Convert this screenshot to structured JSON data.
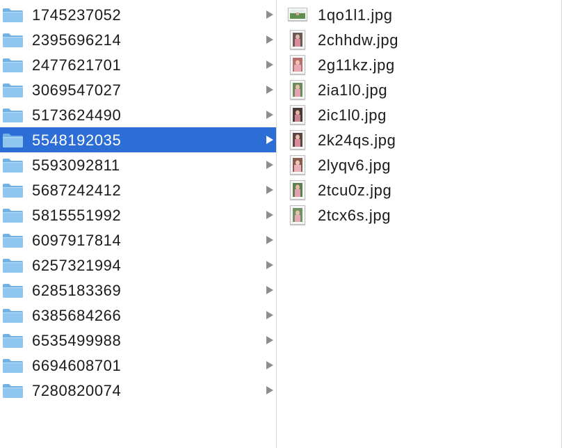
{
  "folders": [
    {
      "name": "1745237052",
      "selected": false
    },
    {
      "name": "2395696214",
      "selected": false
    },
    {
      "name": "2477621701",
      "selected": false
    },
    {
      "name": "3069547027",
      "selected": false
    },
    {
      "name": "5173624490",
      "selected": false
    },
    {
      "name": "5548192035",
      "selected": true
    },
    {
      "name": "5593092811",
      "selected": false
    },
    {
      "name": "5687242412",
      "selected": false
    },
    {
      "name": "5815551992",
      "selected": false
    },
    {
      "name": "6097917814",
      "selected": false
    },
    {
      "name": "6257321994",
      "selected": false
    },
    {
      "name": "6285183369",
      "selected": false
    },
    {
      "name": "6385684266",
      "selected": false
    },
    {
      "name": "6535499988",
      "selected": false
    },
    {
      "name": "6694608701",
      "selected": false
    },
    {
      "name": "7280820074",
      "selected": false
    }
  ],
  "files": [
    {
      "name": "1qo1l1.jpg",
      "icon": "landscape-photo-thumbnail-icon"
    },
    {
      "name": "2chhdw.jpg",
      "icon": "portrait-photo-thumbnail-icon"
    },
    {
      "name": "2g11kz.jpg",
      "icon": "portrait-photo-thumbnail-icon"
    },
    {
      "name": "2ia1l0.jpg",
      "icon": "portrait-photo-thumbnail-icon"
    },
    {
      "name": "2ic1l0.jpg",
      "icon": "portrait-photo-thumbnail-icon"
    },
    {
      "name": "2k24qs.jpg",
      "icon": "portrait-photo-thumbnail-icon"
    },
    {
      "name": "2lyqv6.jpg",
      "icon": "portrait-photo-thumbnail-icon"
    },
    {
      "name": "2tcu0z.jpg",
      "icon": "portrait-photo-thumbnail-icon"
    },
    {
      "name": "2tcx6s.jpg",
      "icon": "portrait-photo-thumbnail-icon"
    }
  ],
  "colors": {
    "selection": "#2c6ed6",
    "folder_body": "#8fc6ef",
    "folder_tab": "#72b1e4",
    "chevron": "#8d8d8d"
  }
}
